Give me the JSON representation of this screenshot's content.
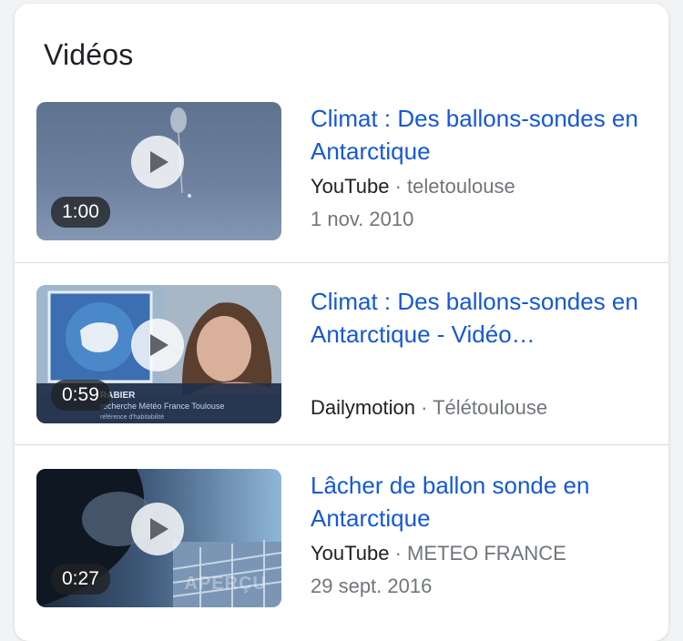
{
  "section": {
    "title": "Vidéos"
  },
  "videos": [
    {
      "title": "Climat : Des ballons-sondes en Antarctique",
      "source": "YouTube",
      "separator": "·",
      "channel": "teletoulouse",
      "date": "1 nov. 2010",
      "duration": "1:00"
    },
    {
      "title": "Climat : Des ballons-sondes en Antarctique - Vidéo…",
      "source": "Dailymotion",
      "separator": "·",
      "channel": "Télétoulouse",
      "date": "",
      "duration": "0:59"
    },
    {
      "title": "Lâcher de ballon sonde en Antarctique",
      "source": "YouTube",
      "separator": "·",
      "channel": "METEO FRANCE",
      "date": "29 sept. 2016",
      "duration": "0:27",
      "thumb_watermark": "APERÇU"
    }
  ],
  "icons": {
    "play": "play-icon"
  },
  "colors": {
    "title_link": "#1558d6",
    "meta_gray": "#70757a",
    "source_dark": "#202124"
  }
}
